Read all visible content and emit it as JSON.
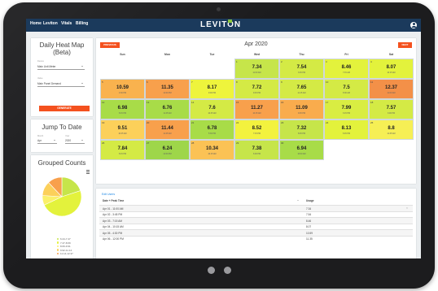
{
  "nav": {
    "links": [
      "Home",
      "Leviton",
      "Vitals",
      "Billing"
    ],
    "logo": "LEVITON"
  },
  "heatmap_form": {
    "title_line1": "Daily Heat Map",
    "title_line2": "(Beta)",
    "device_label": "Device",
    "device_value": "Main Unit Meter",
    "value_label": "Value",
    "value_value": "Main Panel Demand",
    "generate_label": "GENERATE"
  },
  "jump": {
    "title": "Jump To Date",
    "month_label": "Month",
    "month_value": "Apr",
    "year_label": "Year",
    "year_value": "2020"
  },
  "grouped": {
    "title": "Grouped Counts",
    "legend": [
      {
        "label": "6.24-7.47",
        "color": "#c6e54a"
      },
      {
        "label": "7.47-8.69",
        "color": "#e3f23c"
      },
      {
        "label": "8.69-9.91",
        "color": "#fbf06a"
      },
      {
        "label": "9.92-11.14",
        "color": "#fcd05a"
      },
      {
        "label": "11.14-12.37",
        "color": "#f8a04c"
      }
    ],
    "slices": [
      {
        "label": "6.24-7.47",
        "count": 5,
        "color": "#c6e54a"
      },
      {
        "label": "7.47-8.69",
        "count": 12,
        "color": "#e3f23c"
      },
      {
        "label": "8.69-9.91",
        "count": 2,
        "color": "#fbf06a"
      },
      {
        "label": "9.92-11.14",
        "count": 3,
        "color": "#fcd05a"
      },
      {
        "label": "11.14-12.37",
        "count": 3,
        "color": "#f8a04c"
      }
    ]
  },
  "calendar": {
    "prev_label": "PREVIOUS",
    "next_label": "NEXT",
    "month_title": "Apr 2020",
    "weekdays": [
      "Sun",
      "Mon",
      "Tue",
      "Wed",
      "Thu",
      "Fri",
      "Sat"
    ],
    "first_weekday": 3,
    "days": [
      {
        "day": "1",
        "usage": "7.34",
        "time": "11:00 AM",
        "color": "#c6e54a"
      },
      {
        "day": "2",
        "usage": "7.54",
        "time": "3:45 PM",
        "color": "#d4ea45"
      },
      {
        "day": "3",
        "usage": "8.46",
        "time": "7:15 AM",
        "color": "#e3f23c"
      },
      {
        "day": "4",
        "usage": "8.07",
        "time": "10:15 AM",
        "color": "#e3f23c"
      },
      {
        "day": "5",
        "usage": "10.59",
        "time": "4:30 PM",
        "color": "#f9b24e"
      },
      {
        "day": "6",
        "usage": "11.35",
        "time": "12:00 PM",
        "color": "#f8a04c"
      },
      {
        "day": "7",
        "usage": "8.17",
        "time": "9:00 PM",
        "color": "#eef43c"
      },
      {
        "day": "8",
        "usage": "7.72",
        "time": "9:45 PM",
        "color": "#d4ea45"
      },
      {
        "day": "9",
        "usage": "7.65",
        "time": "11:15 AM",
        "color": "#d4ea45"
      },
      {
        "day": "10",
        "usage": "7.5",
        "time": "8:30 AM",
        "color": "#d4ea45"
      },
      {
        "day": "11",
        "usage": "12.37",
        "time": "11:00 AM",
        "color": "#f39048"
      },
      {
        "day": "12",
        "usage": "6.98",
        "time": "8:15 PM",
        "color": "#a8dc48"
      },
      {
        "day": "13",
        "usage": "6.76",
        "time": "11:45 AM",
        "color": "#a8dc48"
      },
      {
        "day": "14",
        "usage": "7.6",
        "time": "10:45 AM",
        "color": "#d4ea45"
      },
      {
        "day": "15",
        "usage": "11.27",
        "time": "10:15 AM",
        "color": "#f8a04c"
      },
      {
        "day": "16",
        "usage": "11.09",
        "time": "9:45 PM",
        "color": "#f9ac4d"
      },
      {
        "day": "17",
        "usage": "7.99",
        "time": "3:15 PM",
        "color": "#d9ed42"
      },
      {
        "day": "18",
        "usage": "7.57",
        "time": "3:00 PM",
        "color": "#d4ea45"
      },
      {
        "day": "19",
        "usage": "9.51",
        "time": "10:45 AM",
        "color": "#fcd05a"
      },
      {
        "day": "20",
        "usage": "11.44",
        "time": "11:45 AM",
        "color": "#f8a04c"
      },
      {
        "day": "21",
        "usage": "6.78",
        "time": "5:30 PM",
        "color": "#a8dc48"
      },
      {
        "day": "22",
        "usage": "8.52",
        "time": "7:15 PM",
        "color": "#f3f23e"
      },
      {
        "day": "23",
        "usage": "7.32",
        "time": "8:45 PM",
        "color": "#c6e54a"
      },
      {
        "day": "24",
        "usage": "8.13",
        "time": "6:45 PM",
        "color": "#e3f23c"
      },
      {
        "day": "25",
        "usage": "8.8",
        "time": "11:45 AM",
        "color": "#f6ef55"
      },
      {
        "day": "26",
        "usage": "7.84",
        "time": "8:15 PM",
        "color": "#d4ea45"
      },
      {
        "day": "27",
        "usage": "6.24",
        "time": "12:00 PM",
        "color": "#9ed64a"
      },
      {
        "day": "28",
        "usage": "10.34",
        "time": "10:15 AM",
        "color": "#fbc255"
      },
      {
        "day": "29",
        "usage": "7.38",
        "time": "6:00 PM",
        "color": "#c6e54a"
      },
      {
        "day": "30",
        "usage": "6.94",
        "time": "10:00 AM",
        "color": "#a8dc48"
      }
    ]
  },
  "list": {
    "link": "Edit Users",
    "col_date": "Date + Peak Time",
    "col_usage": "Usage",
    "close_glyph": "×",
    "rows": [
      {
        "date": "Apr 01 - 11:00 AM",
        "usage": "7.34"
      },
      {
        "date": "Apr 02 - 3:45 PM",
        "usage": "7.54"
      },
      {
        "date": "Apr 03 - 7:15 AM",
        "usage": "8.46"
      },
      {
        "date": "Apr 04 - 10:15 AM",
        "usage": "8.07"
      },
      {
        "date": "Apr 05 - 4:30 PM",
        "usage": "10.59"
      },
      {
        "date": "Apr 06 - 12:00 PM",
        "usage": "11.35"
      }
    ]
  }
}
